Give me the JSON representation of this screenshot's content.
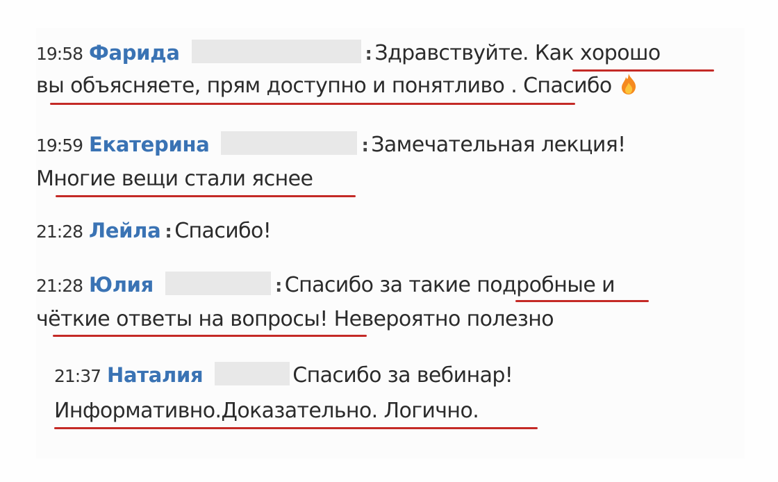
{
  "colors": {
    "author": "#3a73b4",
    "underline": "#c42a26",
    "text": "#2b2b2b",
    "redacted": "#e8e8e8"
  },
  "messages": [
    {
      "time": "19:58",
      "author": "Фарида",
      "separator": ":",
      "line1": "Здравствуйте. Как хорошо",
      "line2": "вы объясняете, прям доступно и понятливо . Спасибо",
      "emoji": "fire-icon"
    },
    {
      "time": "19:59",
      "author": "Екатерина",
      "separator": ":",
      "line1": "Замечательная лекция!",
      "line2": "Многие вещи стали яснее"
    },
    {
      "time": "21:28",
      "author": "Лейла",
      "separator": ":",
      "line1": "Спасибо!"
    },
    {
      "time": "21:28",
      "author": "Юлия",
      "separator": ":",
      "line1": "Спасибо за такие подробные и",
      "line2": "чёткие ответы на вопросы! Невероятно полезно"
    },
    {
      "time": "21:37",
      "author": "Наталия",
      "line1": "Спасибо за вебинар!",
      "line2": "Информативно.Доказательно. Логично."
    }
  ]
}
